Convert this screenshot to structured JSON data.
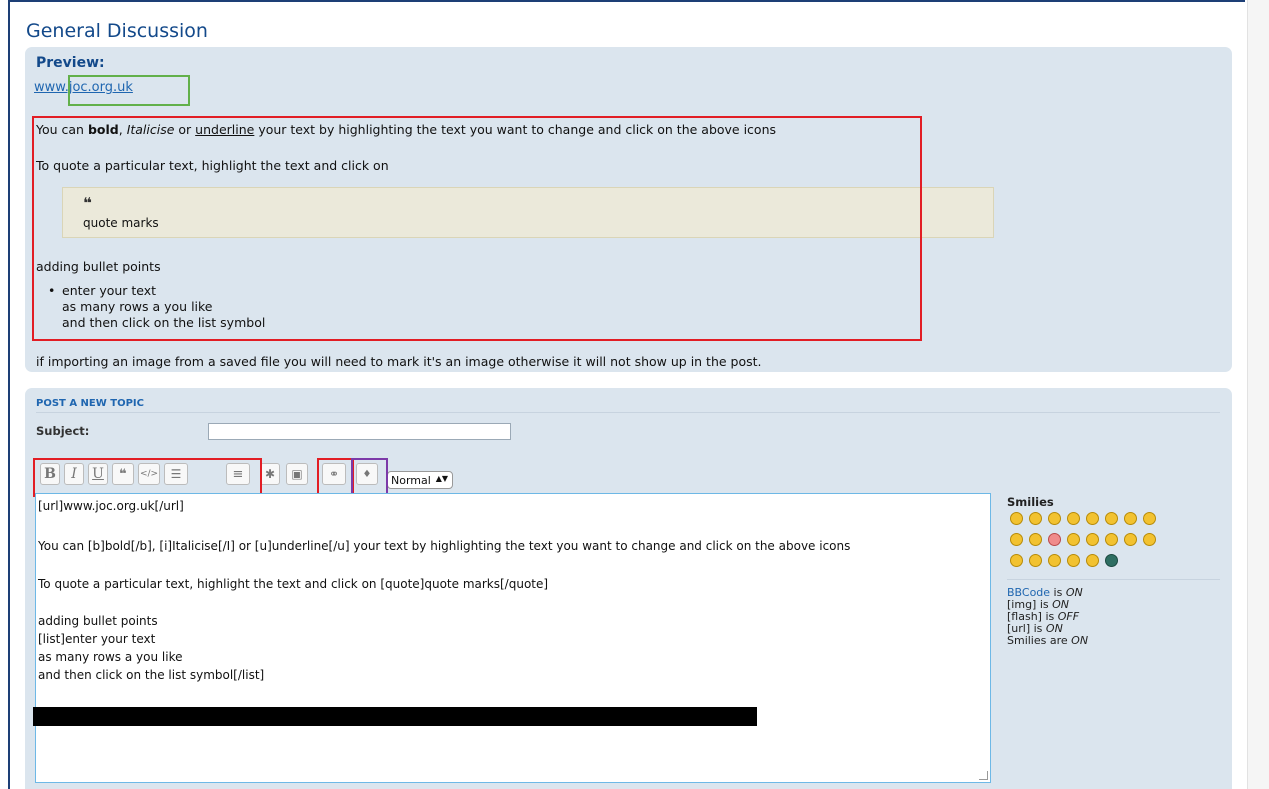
{
  "page": {
    "title": "General Discussion"
  },
  "preview": {
    "label": "Preview:",
    "link_text": "www.joc.org.uk",
    "line1": {
      "prefix": "You can ",
      "bold": "bold",
      "sep1": ", ",
      "italic": "Italicise",
      "sep2": " or ",
      "underline": "underline",
      "suffix": " your text by highlighting the text you want to change and click on the above icons"
    },
    "line2": "To quote a particular text, highlight the text and click on",
    "quote_icon": "❝",
    "quote_text": "quote marks",
    "line3": "adding bullet points",
    "bullets": [
      "enter your text",
      "as many rows a you like",
      "and then click on the list symbol"
    ],
    "line4": "if importing an image from a saved file you will need to mark it's an image otherwise it will not show up in the post."
  },
  "post": {
    "section_title": "POST A NEW TOPIC",
    "subject_label": "Subject:",
    "subject_value": "",
    "font_size_selected": "Normal",
    "editor_lines": [
      "[url]www.joc.org.uk[/url]",
      "You can [b]bold[/b], [i]Italicise[/I] or [u]underline[/u] your text by highlighting the text you want to change and click on the above icons",
      "To quote a particular text, highlight the text and click on [quote]quote marks[/quote]",
      "adding bullet points",
      "[list]enter your text",
      "as many rows a you like",
      "and then click on the list symbol[/list]"
    ],
    "toolbar": [
      {
        "name": "bold-button",
        "glyph": "B"
      },
      {
        "name": "italic-button",
        "glyph": "I"
      },
      {
        "name": "underline-button",
        "glyph": "U"
      },
      {
        "name": "quote-button",
        "glyph": "❝"
      },
      {
        "name": "code-button",
        "glyph": "</>"
      },
      {
        "name": "bullet-list-button",
        "glyph": "☰"
      },
      {
        "name": "numbered-list-button",
        "glyph": "≡"
      },
      {
        "name": "list-item-button",
        "glyph": "✱"
      },
      {
        "name": "image-button",
        "glyph": "▣"
      },
      {
        "name": "link-button",
        "glyph": "⚭"
      },
      {
        "name": "color-button",
        "glyph": "♦"
      }
    ]
  },
  "sidebar": {
    "smilies_title": "Smilies",
    "bbcode_link": "BBCode",
    "bbcode_suffix": " is ",
    "bbcode_state": "ON",
    "img_label": "[img] is ",
    "img_state": "ON",
    "flash_label": "[flash] is ",
    "flash_state": "OFF",
    "url_label": "[url] is ",
    "url_state": "ON",
    "smilies_label": "Smilies are ",
    "smilies_state": "ON"
  }
}
